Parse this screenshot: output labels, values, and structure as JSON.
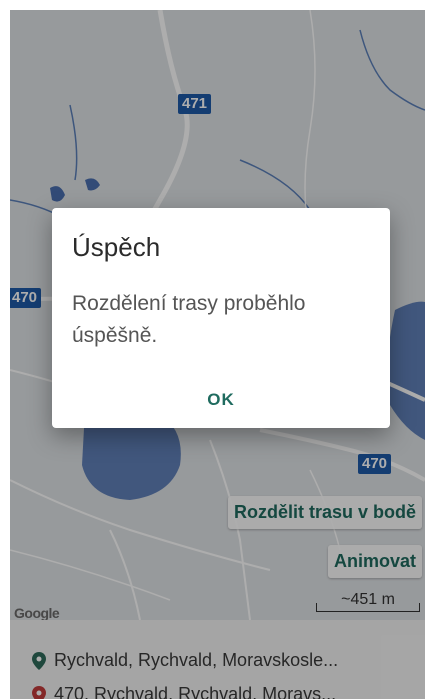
{
  "map": {
    "road_badges": [
      "471",
      "470",
      "470"
    ],
    "split_button": "Rozdělit trasu v bodě",
    "animate_button": "Animovat",
    "google_logo": "Google",
    "scale_label": "~451 m"
  },
  "locations": [
    {
      "icon": "location-pin-green-icon",
      "text": "Rychvald, Rychvald, Moravskosle..."
    },
    {
      "icon": "location-pin-red-icon",
      "text": "470, Rychvald, Rychvald, Moravs..."
    }
  ],
  "dialog": {
    "title": "Úspěch",
    "message": "Rozdělení trasy proběhlo úspěšně.",
    "ok_label": "OK"
  },
  "colors": {
    "accent": "#1f6b5f",
    "road_badge": "#1e5aa8",
    "water": "#4a6fb0",
    "pin_green": "#2e6b5a",
    "pin_red": "#c23b3b"
  }
}
